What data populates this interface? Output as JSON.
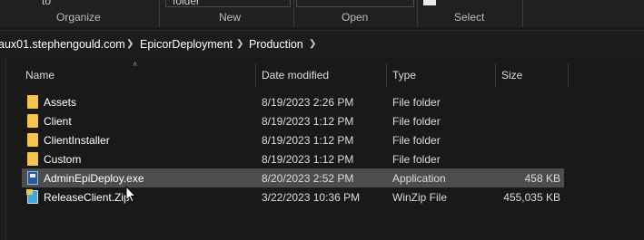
{
  "ribbon": {
    "fragments": {
      "to": "to",
      "folder": "folder"
    },
    "groups": {
      "organize": "Organize",
      "new": "New",
      "open": "Open",
      "select": "Select"
    }
  },
  "address": {
    "crumbs": [
      "aux01.stephengould.com",
      "EpicorDeployment",
      "Production"
    ]
  },
  "columns": {
    "name": "Name",
    "date": "Date modified",
    "type": "Type",
    "size": "Size"
  },
  "files": [
    {
      "name": "Assets",
      "date": "8/19/2023 2:26 PM",
      "type": "File folder",
      "size": "",
      "icon": "folder-icon",
      "selected": false
    },
    {
      "name": "Client",
      "date": "8/19/2023 1:12 PM",
      "type": "File folder",
      "size": "",
      "icon": "folder-icon",
      "selected": false
    },
    {
      "name": "ClientInstaller",
      "date": "8/19/2023 1:12 PM",
      "type": "File folder",
      "size": "",
      "icon": "folder-icon",
      "selected": false
    },
    {
      "name": "Custom",
      "date": "8/19/2023 1:12 PM",
      "type": "File folder",
      "size": "",
      "icon": "folder-icon",
      "selected": false
    },
    {
      "name": "AdminEpiDeploy.exe",
      "date": "8/20/2023 2:52 PM",
      "type": "Application",
      "size": "458 KB",
      "icon": "application-icon",
      "selected": true
    },
    {
      "name": "ReleaseClient.Zip",
      "date": "3/22/2023 10:36 PM",
      "type": "WinZip File",
      "size": "455,035 KB",
      "icon": "winzip-icon",
      "selected": false
    }
  ],
  "colors": {
    "background": "#191919",
    "selection": "#4d4d4d",
    "folder": "#f4c44f"
  }
}
